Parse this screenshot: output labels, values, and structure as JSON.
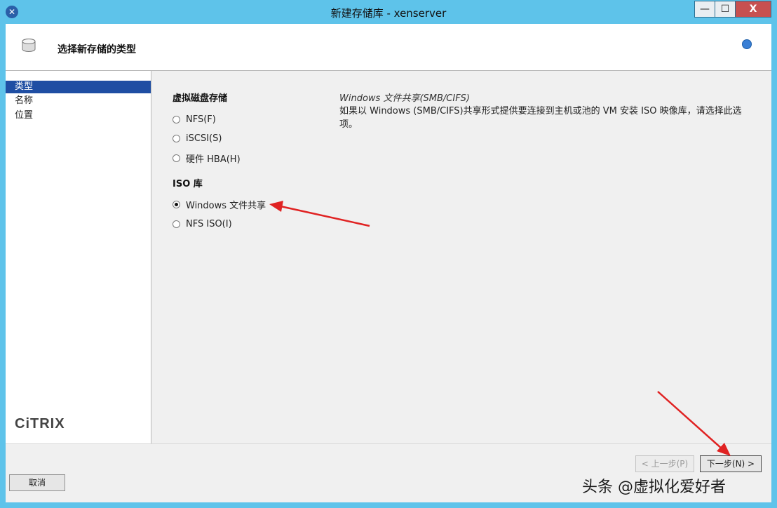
{
  "window": {
    "title": "新建存储库 - xenserver",
    "min_glyph": "—",
    "max_glyph": "☐",
    "close_glyph": "X",
    "app_icon_glyph": "✕"
  },
  "header": {
    "title": "选择新存储的类型"
  },
  "sidebar": {
    "items": [
      {
        "label": "类型",
        "active": true
      },
      {
        "label": "名称",
        "active": false
      },
      {
        "label": "位置",
        "active": false
      }
    ],
    "logo": "CiTRIX"
  },
  "content": {
    "group_vdisk": "虚拟磁盘存储",
    "options_vdisk": [
      {
        "label": "NFS(F)",
        "checked": false
      },
      {
        "label": "iSCSI(S)",
        "checked": false
      },
      {
        "label": "硬件 HBA(H)",
        "checked": false
      }
    ],
    "group_iso": "ISO 库",
    "options_iso": [
      {
        "label": "Windows 文件共享",
        "checked": true
      },
      {
        "label": "NFS ISO(I)",
        "checked": false
      }
    ],
    "desc_title": "Windows 文件共享(SMB/CIFS)",
    "desc_text": "如果以 Windows (SMB/CIFS)共享形式提供要连接到主机或池的 VM 安装 ISO 映像库，请选择此选项。"
  },
  "buttons": {
    "back": "< 上一步(P)",
    "next": "下一步(N) >",
    "cancel": "取消"
  },
  "watermark": "头条 @虚拟化爱好者",
  "colors": {
    "titlebar": "#5ec3ea",
    "selection": "#1f4ea3",
    "arrow": "#e02222"
  }
}
